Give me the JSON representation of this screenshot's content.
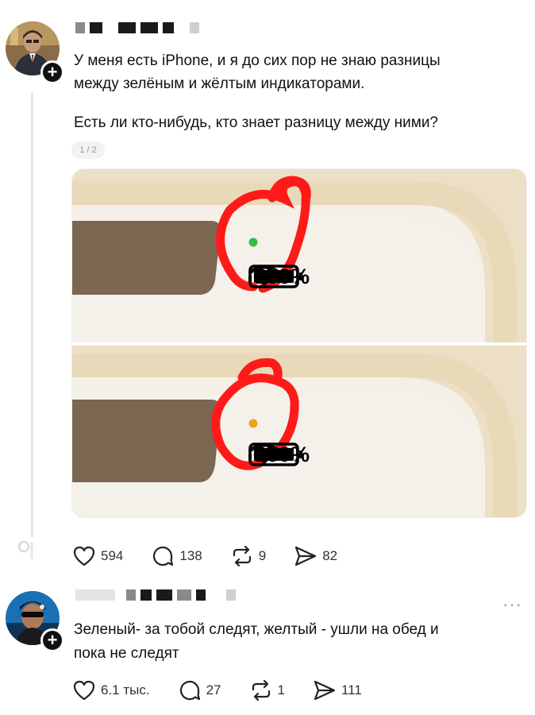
{
  "post": {
    "text_line1": "У меня есть iPhone, и я до сих пор не знаю разницы",
    "text_line2": "между зелёным и жёлтым индикаторами.",
    "text_line3": "Есть ли кто-нибудь, кто знает разницу между ними?",
    "page_indicator": "1 / 2",
    "battery_top": "100%",
    "battery_bottom": "100%",
    "indicator_colors": {
      "green": "#2fbf4a",
      "orange": "#f0a21c",
      "circle": "#ff1a1a"
    },
    "actions": {
      "likes": "594",
      "replies": "138",
      "reposts": "9",
      "shares": "82"
    }
  },
  "reply": {
    "text_line1": "Зеленый- за тобой следят, желтый - ушли на обед и",
    "text_line2": "пока не следят",
    "more_label": "···",
    "actions": {
      "likes": "6.1 тыс.",
      "replies": "27",
      "reposts": "1",
      "shares": "111"
    }
  },
  "icons": {
    "follow": "plus-icon",
    "like": "heart-icon",
    "reply": "comment-icon",
    "repost": "repost-icon",
    "share": "send-icon",
    "wifi": "wifi-icon",
    "signal": "signal-icon",
    "battery": "battery-icon"
  },
  "follow_label": "+"
}
